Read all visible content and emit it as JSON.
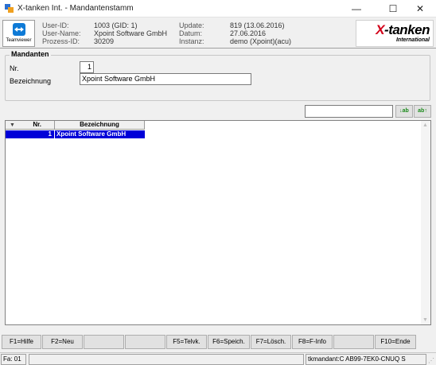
{
  "window": {
    "title": "X-tanken Int. - Mandantenstamm",
    "controls": {
      "minimize": "—",
      "maximize": "☐",
      "close": "✕"
    }
  },
  "info": {
    "teamviewer_label": "Teamviewer",
    "user_id_label": "User-ID:",
    "user_id_value": "1003 (GID: 1)",
    "user_name_label": "User-Name:",
    "user_name_value": "Xpoint Software GmbH",
    "prozess_id_label": "Prozess-ID:",
    "prozess_id_value": "30209",
    "update_label": "Update:",
    "update_value": "819 (13.06.2016)",
    "datum_label": "Datum:",
    "datum_value": "27.06.2016",
    "instanz_label": "Instanz:",
    "instanz_value": "demo (Xpoint)(acu)",
    "logo_x": "X",
    "logo_rest": "-tanken",
    "logo_sub": "International",
    "brand_color": "#d2001a"
  },
  "mandanten": {
    "group_title": "Mandanten",
    "nr_label": "Nr.",
    "nr_value": "1",
    "bez_label": "Bezeichnung",
    "bez_value": "Xpoint Software GmbH"
  },
  "search": {
    "value": "",
    "btn_asc": "↓ab",
    "btn_desc": "ab↑"
  },
  "table": {
    "columns": [
      "Nr.",
      "Bezeichnung"
    ],
    "rows": [
      {
        "nr": "1",
        "bezeichnung": "Xpoint Software GmbH",
        "selected": true
      }
    ],
    "selection_color": "#0000d8"
  },
  "fkeys": [
    "F1=Hilfe",
    "F2=Neu",
    "",
    "",
    "F5=Telvk.",
    "F6=Speich.",
    "F7=Lösch.",
    "F8=F-Info",
    "",
    "F10=Ende"
  ],
  "status": {
    "left": "Fa: 01",
    "mid": "",
    "right": "tkmandant:C AB99-7EK0-CNUQ S"
  }
}
